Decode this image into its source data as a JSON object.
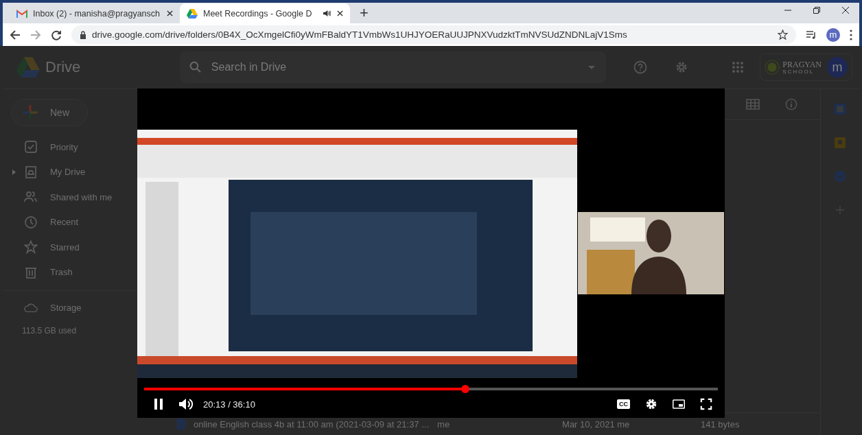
{
  "browser": {
    "tabs": [
      {
        "title": "Inbox (2) - manisha@pragyansch",
        "selected": false,
        "audio": false
      },
      {
        "title": "Meet Recordings - Google D",
        "selected": true,
        "audio": true
      }
    ],
    "new_tab": "+",
    "url": "drive.google.com/drive/folders/0B4X_OcXmgelCfi0yWmFBaldYT1VmbWs1UHJYOERaUUJPNXVudzktTmNVSUdZNDNLajV1Sms",
    "avatar": "m"
  },
  "drive": {
    "app_name": "Drive",
    "search": {
      "placeholder": "Search in Drive"
    },
    "school_logo": {
      "name": "PRAGYAN",
      "sub": "SCHOOL"
    },
    "avatar": "m",
    "new_button": "New",
    "nav": [
      {
        "label": "Priority",
        "selected": false,
        "expandable": false
      },
      {
        "label": "My Drive",
        "selected": false,
        "expandable": true
      },
      {
        "label": "Shared with me",
        "selected": false,
        "expandable": false
      },
      {
        "label": "Recent",
        "selected": false,
        "expandable": false
      },
      {
        "label": "Starred",
        "selected": false,
        "expandable": false
      },
      {
        "label": "Trash",
        "selected": false,
        "expandable": false
      }
    ],
    "storage": {
      "label": "Storage",
      "used": "113.5 GB used"
    },
    "files": [
      {
        "name": "online English class 4b at 11:00 am (2021-03-09 at 21:37 ...",
        "owner": "me",
        "modified": "Mar 10, 2021 me",
        "size": "141 bytes"
      }
    ]
  },
  "player": {
    "playing": true,
    "level": 0.56,
    "time": "20:13 / 36:10",
    "cc": "CC"
  }
}
